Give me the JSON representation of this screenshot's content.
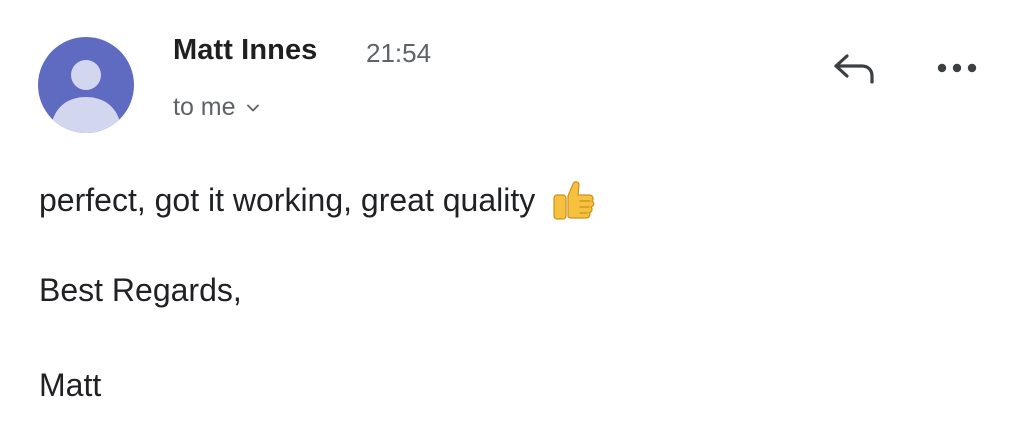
{
  "email": {
    "sender_name": "Matt Innes",
    "sent_time": "21:54",
    "recipient_text": "to me",
    "body_lines": [
      "perfect, got it working, great quality",
      "Best Regards,",
      "Matt"
    ]
  },
  "icons": {
    "avatar": "person-avatar-icon",
    "recipient_toggle": "chevron-down-icon",
    "reply": "reply-arrow-icon",
    "more": "more-horizontal-icon",
    "emoji": "thumbs-up-icon"
  },
  "colors": {
    "avatar_bg": "#5f6bc0",
    "avatar_figure": "#d3d6ef",
    "text_primary": "#202124",
    "text_secondary": "#5f6368",
    "emoji_yellow": "#f6c13f"
  }
}
